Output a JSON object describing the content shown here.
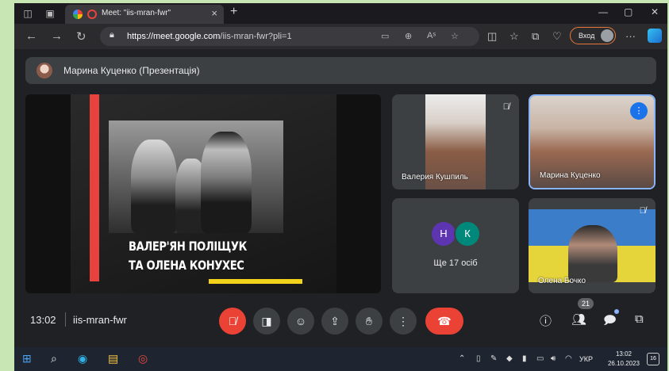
{
  "browser": {
    "tab_title": "Meet: \"iis-mran-fwr\"",
    "url_host": "https://meet.google.com",
    "url_path": "/iis-mran-fwr?pli=1",
    "login_label": "Вход"
  },
  "presentation": {
    "presenter_label": "Марина Куценко (Презентація)",
    "slide_title_line1": "ВАЛЕР'ЯН ПОЛІЩУК",
    "slide_title_line2": "ТА ОЛЕНА КОНУХЕС"
  },
  "participants": [
    {
      "name": "Валерия Кушпиль",
      "muted": true
    },
    {
      "name": "Марина Куценко",
      "speaking": true
    },
    {
      "name": "Олена Бочко",
      "muted": true
    }
  ],
  "others": {
    "avatar1": "Н",
    "avatar2": "К",
    "label": "Ще 17 осіб"
  },
  "meeting": {
    "time": "13:02",
    "code": "iis-mran-fwr",
    "people_count": "21"
  },
  "taskbar": {
    "lang": "УКР",
    "time": "13:02",
    "date": "26.10.2023",
    "notifications": "16"
  },
  "colors": {
    "accent_blue": "#1a73e8",
    "danger_red": "#ea4335",
    "meet_bg": "#202124"
  }
}
